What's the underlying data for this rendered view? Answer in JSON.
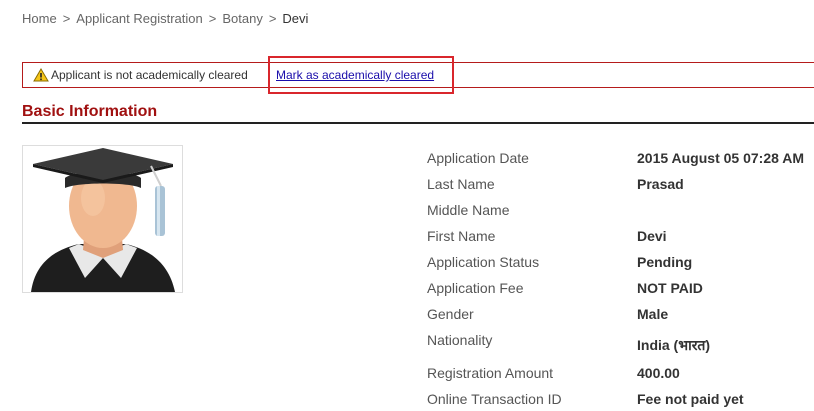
{
  "breadcrumb": {
    "items": [
      "Home",
      "Applicant Registration",
      "Botany",
      "Devi"
    ],
    "separator": ">"
  },
  "alert": {
    "icon": "warning-icon",
    "message": "Applicant is not academically cleared",
    "action_label": "Mark as academically cleared"
  },
  "section": {
    "title": "Basic Information"
  },
  "avatar": {
    "icon": "graduate-avatar-icon"
  },
  "info": [
    {
      "label": "Application Date",
      "value": "2015 August 05 07:28 AM"
    },
    {
      "label": "Last Name",
      "value": "Prasad"
    },
    {
      "label": "Middle Name",
      "value": ""
    },
    {
      "label": "First Name",
      "value": "Devi"
    },
    {
      "label": "Application Status",
      "value": "Pending"
    },
    {
      "label": "Application Fee",
      "value": "NOT PAID"
    },
    {
      "label": "Gender",
      "value": "Male"
    },
    {
      "label": "Nationality",
      "value": "India (भारत)"
    },
    {
      "label": "Registration Amount",
      "value": "400.00"
    },
    {
      "label": "Online Transaction ID",
      "value": "Fee not paid yet"
    }
  ],
  "colors": {
    "accent": "#a01010",
    "alert_border": "#b51b1b",
    "highlight": "#d9262c",
    "link": "#1a0dab"
  }
}
